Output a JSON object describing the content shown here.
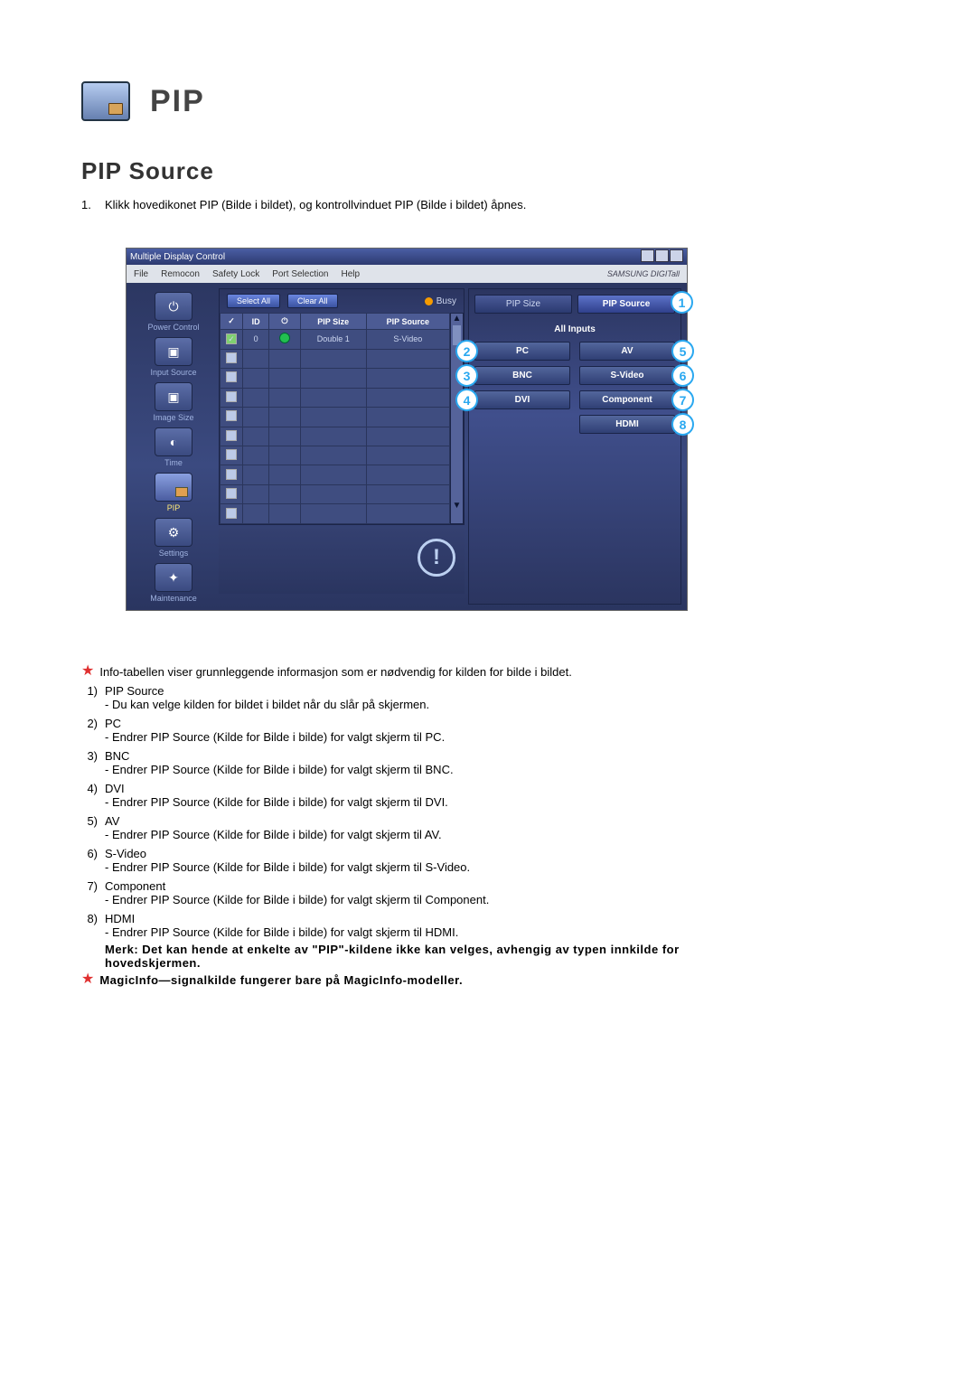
{
  "header": {
    "title": "PIP",
    "section_title": "PIP Source",
    "intro_num": "1.",
    "intro_text": "Klikk hovedikonet PIP (Bilde i bildet), og kontrollvinduet PIP (Bilde i bildet) åpnes."
  },
  "app": {
    "window_title": "Multiple Display Control",
    "brand": "SAMSUNG DIGITall",
    "menu": [
      "File",
      "Remocon",
      "Safety Lock",
      "Port Selection",
      "Help"
    ],
    "sidebar": [
      {
        "label": "Power Control",
        "glyph": "⏻"
      },
      {
        "label": "Input Source",
        "glyph": "▣"
      },
      {
        "label": "Image Size",
        "glyph": "▣"
      },
      {
        "label": "Time",
        "glyph": "◐"
      },
      {
        "label": "PIP",
        "glyph": ""
      },
      {
        "label": "Settings",
        "glyph": "⚙"
      },
      {
        "label": "Maintenance",
        "glyph": "✦"
      }
    ],
    "toolbar": {
      "select_all": "Select All",
      "clear_all": "Clear All",
      "busy": "Busy"
    },
    "table": {
      "headers": [
        "",
        "ID",
        "",
        "PIP Size",
        "PIP Source"
      ],
      "row": {
        "id": "0",
        "pip_size": "Double 1",
        "pip_source": "S-Video"
      }
    },
    "panel": {
      "tab_left": "PIP Size",
      "tab_right": "PIP Source",
      "all_inputs": "All Inputs",
      "btns": [
        "PC",
        "AV",
        "BNC",
        "S-Video",
        "DVI",
        "Component",
        "HDMI"
      ]
    }
  },
  "callouts": [
    "1",
    "2",
    "3",
    "4",
    "5",
    "6",
    "7",
    "8"
  ],
  "notes": {
    "star1": "Info-tabellen viser grunnleggende informasjon som er nødvendig for kilden for bilde i bildet.",
    "items": [
      {
        "n": "1)",
        "t": "PIP Source",
        "d": "- Du kan velge kilden for bildet i bildet når du slår på skjermen."
      },
      {
        "n": "2)",
        "t": "PC",
        "d": "- Endrer PIP Source (Kilde for Bilde i bilde) for valgt skjerm til PC."
      },
      {
        "n": "3)",
        "t": "BNC",
        "d": "- Endrer PIP Source (Kilde for Bilde i bilde) for valgt skjerm til BNC."
      },
      {
        "n": "4)",
        "t": "DVI",
        "d": "- Endrer PIP Source (Kilde for Bilde i bilde) for valgt skjerm til DVI."
      },
      {
        "n": "5)",
        "t": "AV",
        "d": "- Endrer PIP Source (Kilde for Bilde i bilde) for valgt skjerm til AV."
      },
      {
        "n": "6)",
        "t": "S-Video",
        "d": "- Endrer PIP Source (Kilde for Bilde i bilde) for valgt skjerm til S-Video."
      },
      {
        "n": "7)",
        "t": "Component",
        "d": "- Endrer PIP Source (Kilde for Bilde i bilde) for valgt skjerm til Component."
      },
      {
        "n": "8)",
        "t": "HDMI",
        "d": "- Endrer PIP Source (Kilde for Bilde i bilde) for valgt skjerm til HDMI."
      }
    ],
    "merk": "Merk: Det kan hende at enkelte av \"PIP\"-kildene ikke kan velges, avhengig av typen innkilde for hovedskjermen.",
    "star2": "MagicInfo—signalkilde fungerer bare på MagicInfo-modeller."
  }
}
